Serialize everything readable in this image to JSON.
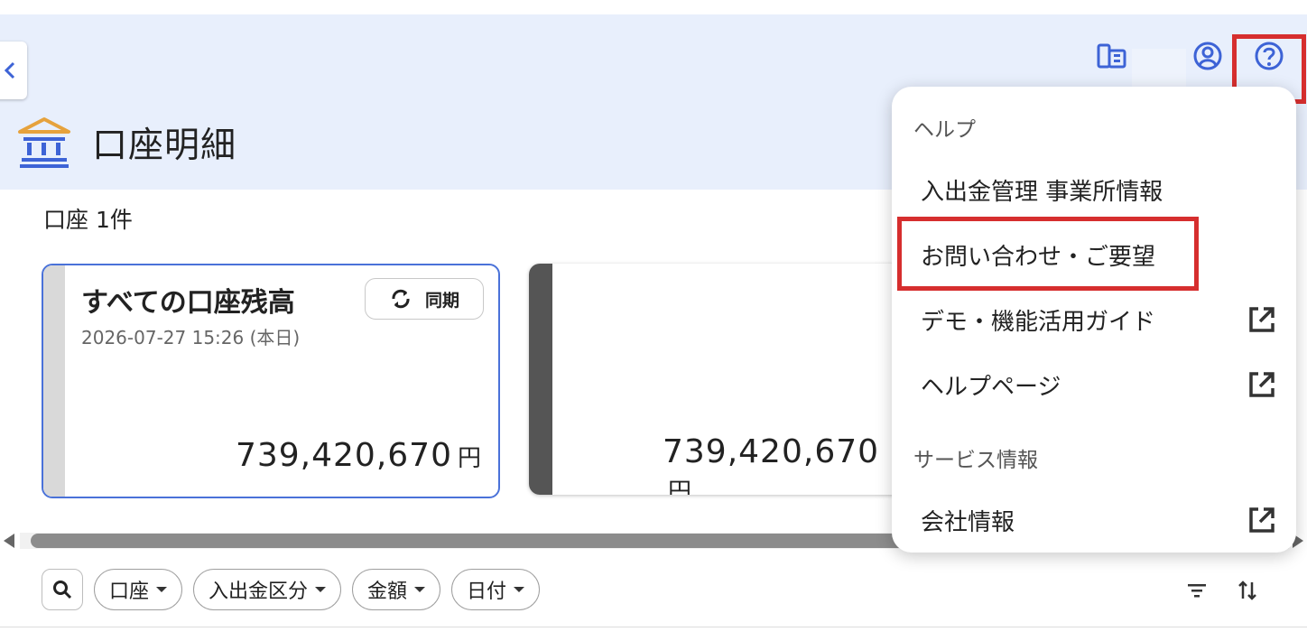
{
  "header": {
    "page_title": "口座明細",
    "icons": [
      "collapse-chevron-icon",
      "office-icon",
      "account-circle-icon",
      "help-icon"
    ]
  },
  "summary": {
    "count_label": "口座 1件"
  },
  "cards": [
    {
      "title": "すべての口座残高",
      "sync_label": "同期",
      "date": "2026-07-27 15:26 (本日)",
      "amount": "739,420,670",
      "currency": "円"
    },
    {
      "amount": "739,420,670",
      "currency": "円"
    }
  ],
  "filters": {
    "chips": [
      "口座",
      "入出金区分",
      "金額",
      "日付"
    ],
    "icons": [
      "search-icon",
      "filter-icon",
      "sort-icon"
    ]
  },
  "help_menu": {
    "section_help": "ヘルプ",
    "items_help": [
      {
        "label": "入出金管理 事業所情報",
        "external": false
      },
      {
        "label": "お問い合わせ・ご要望",
        "external": false,
        "highlighted": true
      },
      {
        "label": "デモ・機能活用ガイド",
        "external": true
      },
      {
        "label": "ヘルプページ",
        "external": true
      }
    ],
    "section_service": "サービス情報",
    "items_service": [
      {
        "label": "会社情報",
        "external": true
      }
    ]
  },
  "colors": {
    "accent": "#3d63d6",
    "header_bg": "#e8effc",
    "highlight": "#d62e2e",
    "card_border": "#4a72d9"
  }
}
